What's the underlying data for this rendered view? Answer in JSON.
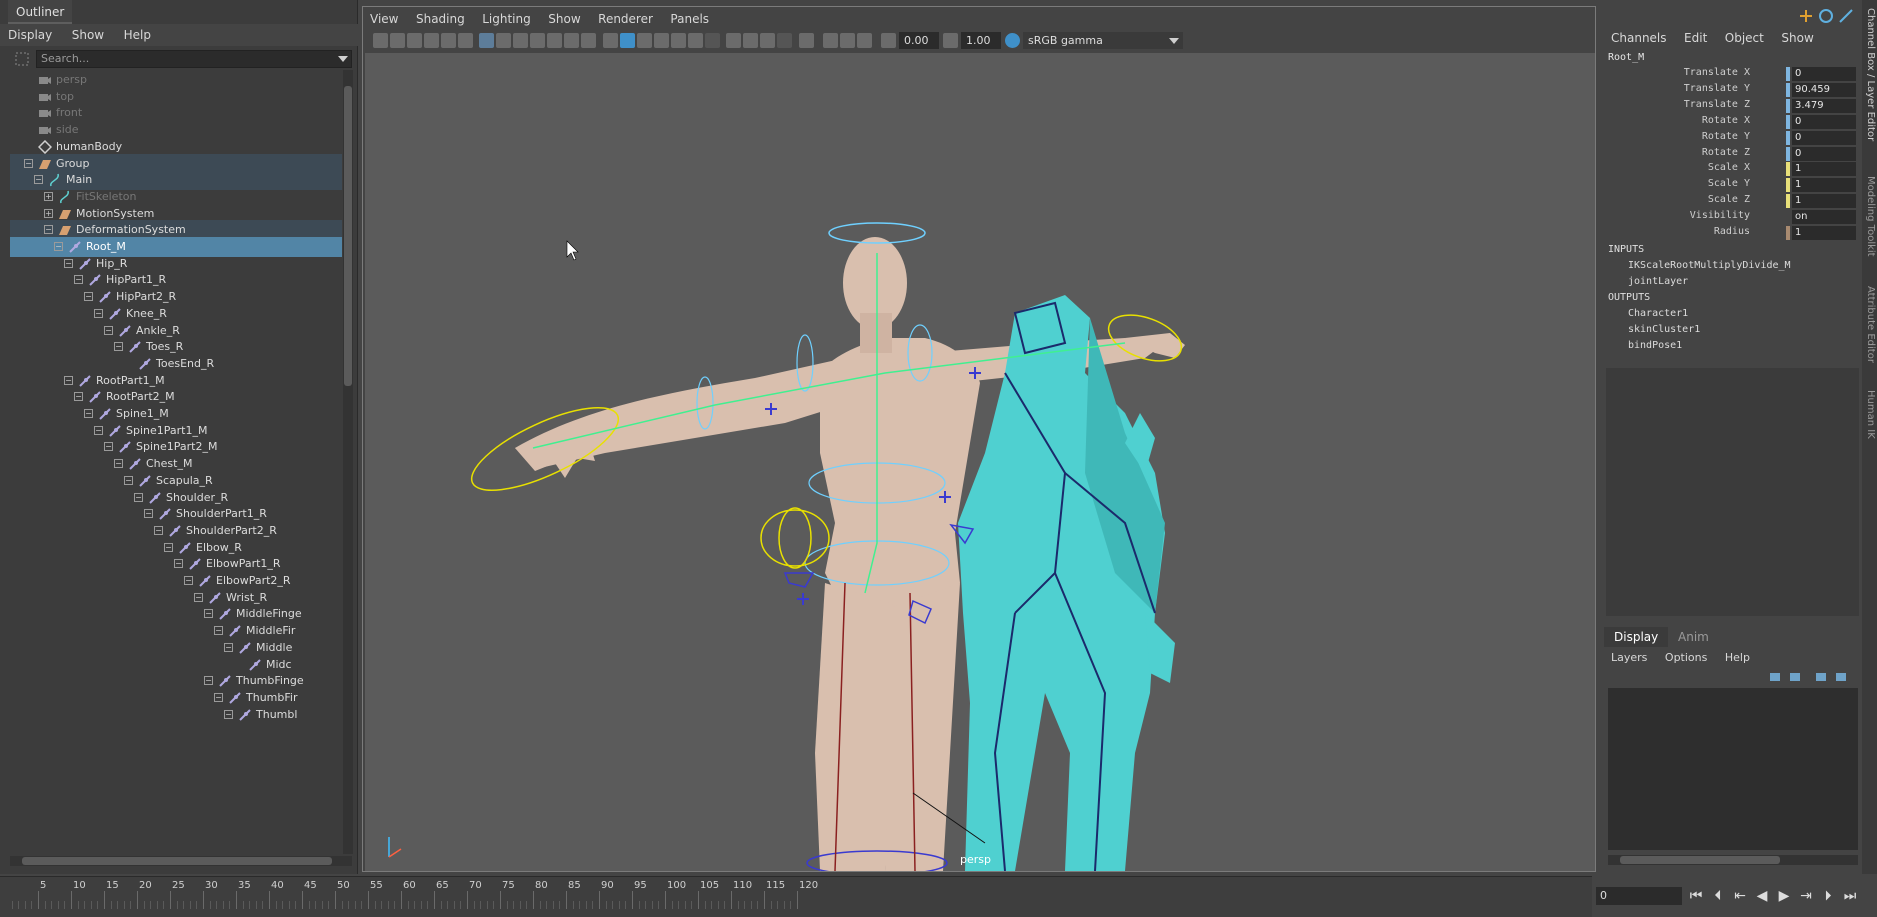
{
  "outliner": {
    "title": "Outliner",
    "menu": [
      "Display",
      "Show",
      "Help"
    ],
    "search_placeholder": "Search...",
    "items": [
      {
        "label": "persp",
        "depth": 0,
        "icon": "camera-icon",
        "dim": true,
        "expander": ""
      },
      {
        "label": "top",
        "depth": 0,
        "icon": "camera-icon",
        "dim": true,
        "expander": ""
      },
      {
        "label": "front",
        "depth": 0,
        "icon": "camera-icon",
        "dim": true,
        "expander": ""
      },
      {
        "label": "side",
        "depth": 0,
        "icon": "camera-icon",
        "dim": true,
        "expander": ""
      },
      {
        "label": "humanBody",
        "depth": 0,
        "icon": "mesh-icon",
        "dim": false,
        "expander": ""
      },
      {
        "label": "Group",
        "depth": 0,
        "icon": "group-icon",
        "dim": false,
        "expander": "−",
        "state": "grp"
      },
      {
        "label": "Main",
        "depth": 1,
        "icon": "curve-icon",
        "dim": false,
        "expander": "−",
        "state": "grp"
      },
      {
        "label": "FitSkeleton",
        "depth": 2,
        "icon": "curve-icon",
        "dim": true,
        "expander": "+"
      },
      {
        "label": "MotionSystem",
        "depth": 2,
        "icon": "group-icon",
        "dim": false,
        "expander": "+"
      },
      {
        "label": "DeformationSystem",
        "depth": 2,
        "icon": "group-icon",
        "dim": false,
        "expander": "−",
        "state": "grp"
      },
      {
        "label": "Root_M",
        "depth": 3,
        "icon": "joint-icon",
        "dim": false,
        "expander": "−",
        "state": "sel"
      },
      {
        "label": "Hip_R",
        "depth": 4,
        "icon": "joint-icon",
        "dim": false,
        "expander": "−"
      },
      {
        "label": "HipPart1_R",
        "depth": 5,
        "icon": "joint-icon",
        "dim": false,
        "expander": "−"
      },
      {
        "label": "HipPart2_R",
        "depth": 6,
        "icon": "joint-icon",
        "dim": false,
        "expander": "−"
      },
      {
        "label": "Knee_R",
        "depth": 7,
        "icon": "joint-icon",
        "dim": false,
        "expander": "−"
      },
      {
        "label": "Ankle_R",
        "depth": 8,
        "icon": "joint-icon",
        "dim": false,
        "expander": "−"
      },
      {
        "label": "Toes_R",
        "depth": 9,
        "icon": "joint-icon",
        "dim": false,
        "expander": "−"
      },
      {
        "label": "ToesEnd_R",
        "depth": 10,
        "icon": "joint-icon",
        "dim": false,
        "expander": ""
      },
      {
        "label": "RootPart1_M",
        "depth": 4,
        "icon": "joint-icon",
        "dim": false,
        "expander": "−"
      },
      {
        "label": "RootPart2_M",
        "depth": 5,
        "icon": "joint-icon",
        "dim": false,
        "expander": "−"
      },
      {
        "label": "Spine1_M",
        "depth": 6,
        "icon": "joint-icon",
        "dim": false,
        "expander": "−"
      },
      {
        "label": "Spine1Part1_M",
        "depth": 7,
        "icon": "joint-icon",
        "dim": false,
        "expander": "−"
      },
      {
        "label": "Spine1Part2_M",
        "depth": 8,
        "icon": "joint-icon",
        "dim": false,
        "expander": "−"
      },
      {
        "label": "Chest_M",
        "depth": 9,
        "icon": "joint-icon",
        "dim": false,
        "expander": "−"
      },
      {
        "label": "Scapula_R",
        "depth": 10,
        "icon": "joint-icon",
        "dim": false,
        "expander": "−"
      },
      {
        "label": "Shoulder_R",
        "depth": 11,
        "icon": "joint-icon",
        "dim": false,
        "expander": "−"
      },
      {
        "label": "ShoulderPart1_R",
        "depth": 12,
        "icon": "joint-icon",
        "dim": false,
        "expander": "−"
      },
      {
        "label": "ShoulderPart2_R",
        "depth": 13,
        "icon": "joint-icon",
        "dim": false,
        "expander": "−"
      },
      {
        "label": "Elbow_R",
        "depth": 14,
        "icon": "joint-icon",
        "dim": false,
        "expander": "−"
      },
      {
        "label": "ElbowPart1_R",
        "depth": 15,
        "icon": "joint-icon",
        "dim": false,
        "expander": "−"
      },
      {
        "label": "ElbowPart2_R",
        "depth": 16,
        "icon": "joint-icon",
        "dim": false,
        "expander": "−"
      },
      {
        "label": "Wrist_R",
        "depth": 17,
        "icon": "joint-icon",
        "dim": false,
        "expander": "−"
      },
      {
        "label": "MiddleFinge",
        "depth": 18,
        "icon": "joint-icon",
        "dim": false,
        "expander": "−"
      },
      {
        "label": "MiddleFir",
        "depth": 19,
        "icon": "joint-icon",
        "dim": false,
        "expander": "−"
      },
      {
        "label": "Middle",
        "depth": 20,
        "icon": "joint-icon",
        "dim": false,
        "expander": "−"
      },
      {
        "label": "Midc",
        "depth": 21,
        "icon": "joint-icon",
        "dim": false,
        "expander": ""
      },
      {
        "label": "ThumbFinge",
        "depth": 18,
        "icon": "joint-icon",
        "dim": false,
        "expander": "−"
      },
      {
        "label": "ThumbFir",
        "depth": 19,
        "icon": "joint-icon",
        "dim": false,
        "expander": "−"
      },
      {
        "label": "Thumbl",
        "depth": 20,
        "icon": "joint-icon",
        "dim": false,
        "expander": "−"
      }
    ]
  },
  "viewport": {
    "menu": [
      "View",
      "Shading",
      "Lighting",
      "Show",
      "Renderer",
      "Panels"
    ],
    "exposure": "0.00",
    "gamma": "1.00",
    "color_space": "sRGB gamma",
    "camera_label": "persp"
  },
  "channel_box": {
    "menu": [
      "Channels",
      "Edit",
      "Object",
      "Show"
    ],
    "node_name": "Root_M",
    "channels": [
      {
        "label": "Translate X",
        "value": "0",
        "key_color": "#7fb6e0"
      },
      {
        "label": "Translate Y",
        "value": "90.459",
        "key_color": "#7fb6e0"
      },
      {
        "label": "Translate Z",
        "value": "3.479",
        "key_color": "#7fb6e0"
      },
      {
        "label": "Rotate X",
        "value": "0",
        "key_color": "#7fb6e0"
      },
      {
        "label": "Rotate Y",
        "value": "0",
        "key_color": "#7fb6e0"
      },
      {
        "label": "Rotate Z",
        "value": "0",
        "key_color": "#7fb6e0"
      },
      {
        "label": "Scale X",
        "value": "1",
        "key_color": "#e8e07a"
      },
      {
        "label": "Scale Y",
        "value": "1",
        "key_color": "#e8e07a"
      },
      {
        "label": "Scale Z",
        "value": "1",
        "key_color": "#e8e07a"
      },
      {
        "label": "Visibility",
        "value": "on",
        "key_color": "#444444"
      },
      {
        "label": "Radius",
        "value": "1",
        "key_color": "#a88a70"
      }
    ],
    "inputs_header": "INPUTS",
    "inputs": [
      "IKScaleRootMultiplyDivide_M",
      "jointLayer"
    ],
    "outputs_header": "OUTPUTS",
    "outputs": [
      "Character1",
      "skinCluster1",
      "bindPose1"
    ]
  },
  "layer_editor": {
    "tabs": [
      "Display",
      "Anim"
    ],
    "active_tab": "Display",
    "menu": [
      "Layers",
      "Options",
      "Help"
    ]
  },
  "side_tabs": [
    "Channel Box / Layer Editor",
    "Modeling Toolkit",
    "Attribute Editor",
    "Human IK"
  ],
  "timeline": {
    "ticks": [
      "5",
      "10",
      "15",
      "20",
      "25",
      "30",
      "35",
      "40",
      "45",
      "50",
      "55",
      "60",
      "65",
      "70",
      "75",
      "80",
      "85",
      "90",
      "95",
      "100",
      "105",
      "110",
      "115",
      "120"
    ],
    "current_frame": "0"
  },
  "colors": {
    "selection": "#5285a6",
    "group_row": "#3d4a55",
    "character_skin": "#d9bfae",
    "character_cyan": "#4fd0d0",
    "viewport_bg": "#5b5b5b"
  }
}
